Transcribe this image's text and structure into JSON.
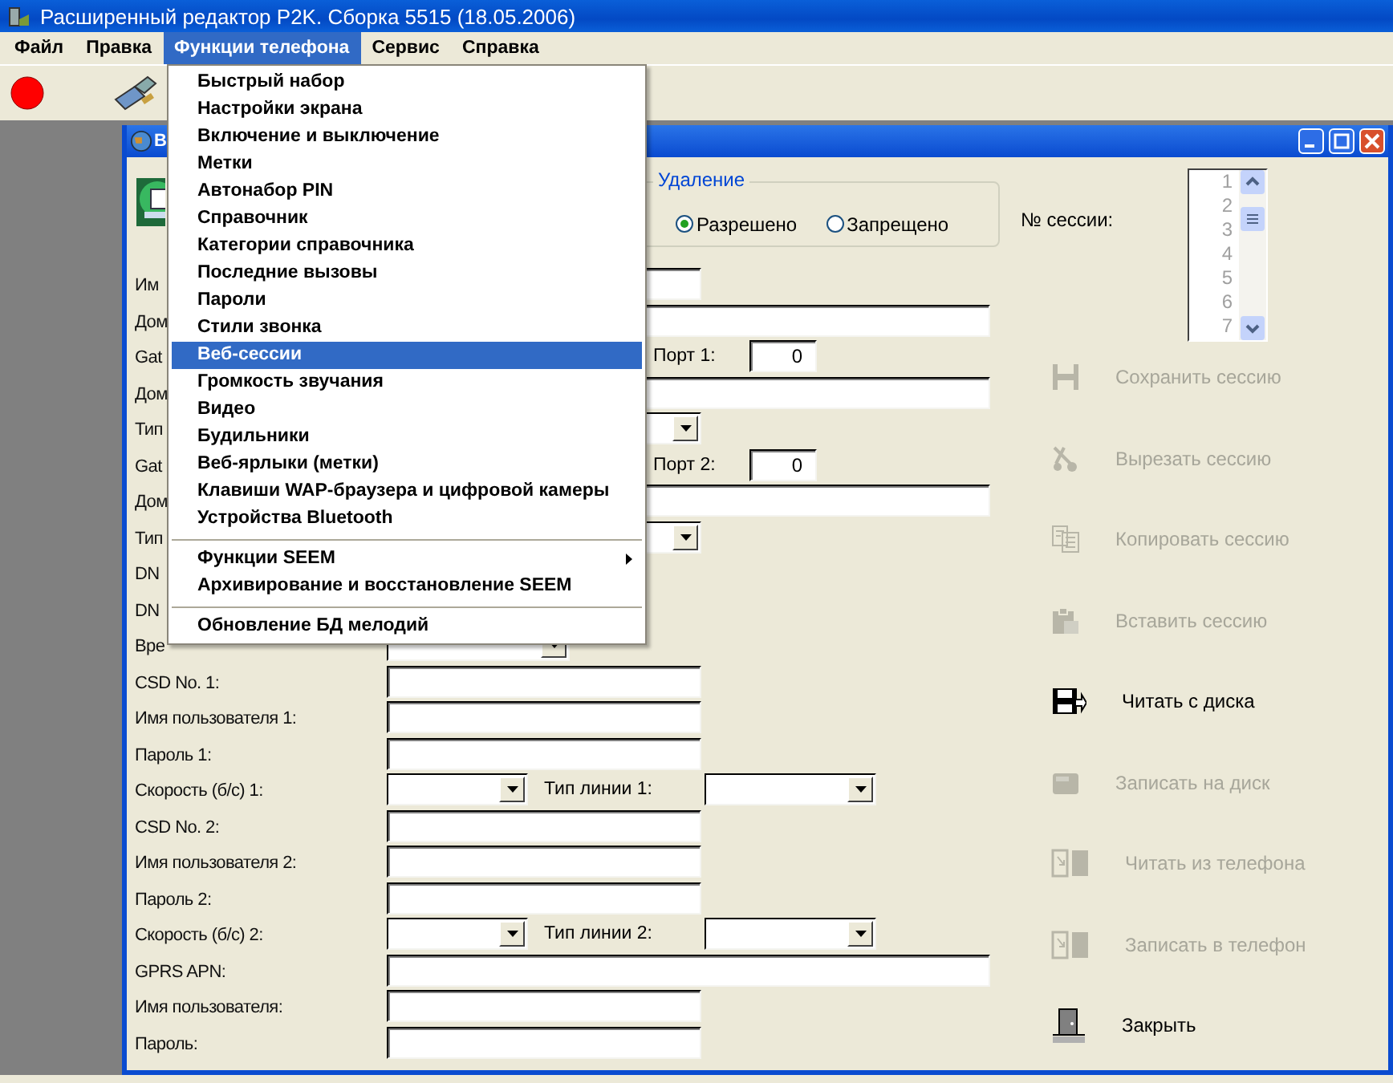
{
  "window": {
    "title": "Расширенный редактор P2K. Сборка 5515 (18.05.2006)"
  },
  "menu_bar": [
    {
      "label": "Файл",
      "selected": false
    },
    {
      "label": "Правка",
      "selected": false
    },
    {
      "label": "Функции телефона",
      "selected": true
    },
    {
      "label": "Сервис",
      "selected": false
    },
    {
      "label": "Справка",
      "selected": false
    }
  ],
  "dropdown_menu": [
    {
      "kind": "item",
      "label": "Быстрый набор",
      "selected": false,
      "has_submenu": false
    },
    {
      "kind": "item",
      "label": "Настройки экрана",
      "selected": false,
      "has_submenu": false
    },
    {
      "kind": "item",
      "label": "Включение и выключение",
      "selected": false,
      "has_submenu": false
    },
    {
      "kind": "item",
      "label": "Метки",
      "selected": false,
      "has_submenu": false
    },
    {
      "kind": "item",
      "label": "Автонабор PIN",
      "selected": false,
      "has_submenu": false
    },
    {
      "kind": "item",
      "label": "Справочник",
      "selected": false,
      "has_submenu": false
    },
    {
      "kind": "item",
      "label": "Категории справочника",
      "selected": false,
      "has_submenu": false
    },
    {
      "kind": "item",
      "label": "Последние вызовы",
      "selected": false,
      "has_submenu": false
    },
    {
      "kind": "item",
      "label": "Пароли",
      "selected": false,
      "has_submenu": false
    },
    {
      "kind": "item",
      "label": "Стили звонка",
      "selected": false,
      "has_submenu": false
    },
    {
      "kind": "item",
      "label": "Веб-сессии",
      "selected": true,
      "has_submenu": false
    },
    {
      "kind": "item",
      "label": "Громкость звучания",
      "selected": false,
      "has_submenu": false
    },
    {
      "kind": "item",
      "label": "Видео",
      "selected": false,
      "has_submenu": false
    },
    {
      "kind": "item",
      "label": "Будильники",
      "selected": false,
      "has_submenu": false
    },
    {
      "kind": "item",
      "label": "Веб-ярлыки (метки)",
      "selected": false,
      "has_submenu": false
    },
    {
      "kind": "item",
      "label": "Клавиши WAP-браузера и цифровой камеры",
      "selected": false,
      "has_submenu": false
    },
    {
      "kind": "item",
      "label": "Устройства Bluetooth",
      "selected": false,
      "has_submenu": false
    },
    {
      "kind": "separator"
    },
    {
      "kind": "item",
      "label": "Функции SEEM",
      "selected": false,
      "has_submenu": true
    },
    {
      "kind": "item",
      "label": "Архивирование и восстановление SEEM",
      "selected": false,
      "has_submenu": false
    },
    {
      "kind": "separator"
    },
    {
      "kind": "item",
      "label": "Обновление БД мелодий",
      "selected": false,
      "has_submenu": false
    }
  ],
  "child_window": {
    "title": "В"
  },
  "deletion": {
    "legend": "Удаление",
    "options": [
      {
        "label": "Разрешено",
        "selected": true
      },
      {
        "label": "Запрещено",
        "selected": false
      }
    ]
  },
  "session": {
    "label": "№ сессии:",
    "numbers": [
      "1",
      "2",
      "3",
      "4",
      "5",
      "6",
      "7"
    ]
  },
  "form": [
    {
      "label": "Им",
      "controls": [
        {
          "kind": "field"
        }
      ]
    },
    {
      "label": "Дом",
      "controls": [
        {
          "kind": "wide-field"
        }
      ]
    },
    {
      "label": "Gat",
      "controls": [
        {
          "kind": "port-label",
          "text": "Порт 1:"
        },
        {
          "kind": "port-field",
          "value": "0"
        }
      ]
    },
    {
      "label": "Дом",
      "controls": [
        {
          "kind": "wide-field"
        }
      ]
    },
    {
      "label": "Тип",
      "controls": [
        {
          "kind": "combo"
        }
      ]
    },
    {
      "label": "Gat",
      "controls": [
        {
          "kind": "port-label",
          "text": "Порт 2:"
        },
        {
          "kind": "port-field",
          "value": "0"
        }
      ]
    },
    {
      "label": "Дом",
      "controls": [
        {
          "kind": "wide-field"
        }
      ]
    },
    {
      "label": "Тип",
      "controls": [
        {
          "kind": "combo"
        }
      ]
    },
    {
      "label": "DN"
    },
    {
      "label": "DN"
    },
    {
      "label": "Вре",
      "controls": [
        {
          "kind": "mid-combo"
        }
      ]
    },
    {
      "label": "CSD No. 1:",
      "controls": [
        {
          "kind": "field"
        }
      ]
    },
    {
      "label": "Имя пользователя 1:",
      "controls": [
        {
          "kind": "field"
        }
      ]
    },
    {
      "label": "Пароль 1:",
      "controls": [
        {
          "kind": "field"
        }
      ]
    },
    {
      "label": "Скорость (б/с) 1:",
      "controls": [
        {
          "kind": "short-combo"
        },
        {
          "kind": "line-label",
          "text": "Тип линии 1:"
        },
        {
          "kind": "line-combo"
        }
      ]
    },
    {
      "label": "CSD No. 2:",
      "controls": [
        {
          "kind": "field"
        }
      ]
    },
    {
      "label": "Имя пользователя 2:",
      "controls": [
        {
          "kind": "field"
        }
      ]
    },
    {
      "label": "Пароль 2:",
      "controls": [
        {
          "kind": "field"
        }
      ]
    },
    {
      "label": "Скорость (б/с) 2:",
      "controls": [
        {
          "kind": "short-combo"
        },
        {
          "kind": "line-label",
          "text": "Тип линии 2:"
        },
        {
          "kind": "line-combo"
        }
      ]
    },
    {
      "label": "GPRS APN:",
      "controls": [
        {
          "kind": "wide-field"
        }
      ]
    },
    {
      "label": "Имя пользователя:",
      "controls": [
        {
          "kind": "field"
        }
      ]
    },
    {
      "label": "Пароль:",
      "controls": [
        {
          "kind": "field"
        }
      ]
    }
  ],
  "actions": [
    {
      "label": "Сохранить сессию",
      "kind": "save",
      "disabled": true
    },
    {
      "label": "Вырезать сессию",
      "kind": "cut",
      "disabled": true
    },
    {
      "label": "Копировать сессию",
      "kind": "copy",
      "disabled": true
    },
    {
      "label": "Вставить сессию",
      "kind": "paste",
      "disabled": true
    },
    {
      "label": "Читать с диска",
      "kind": "load",
      "disabled": false
    },
    {
      "label": "Записать на диск",
      "kind": "write",
      "disabled": true
    },
    {
      "label": "Читать из телефона",
      "kind": "read-phone",
      "disabled": true
    },
    {
      "label": "Записать в телефон",
      "kind": "write-phone",
      "disabled": true
    },
    {
      "label": "Закрыть",
      "kind": "close",
      "disabled": false
    }
  ]
}
